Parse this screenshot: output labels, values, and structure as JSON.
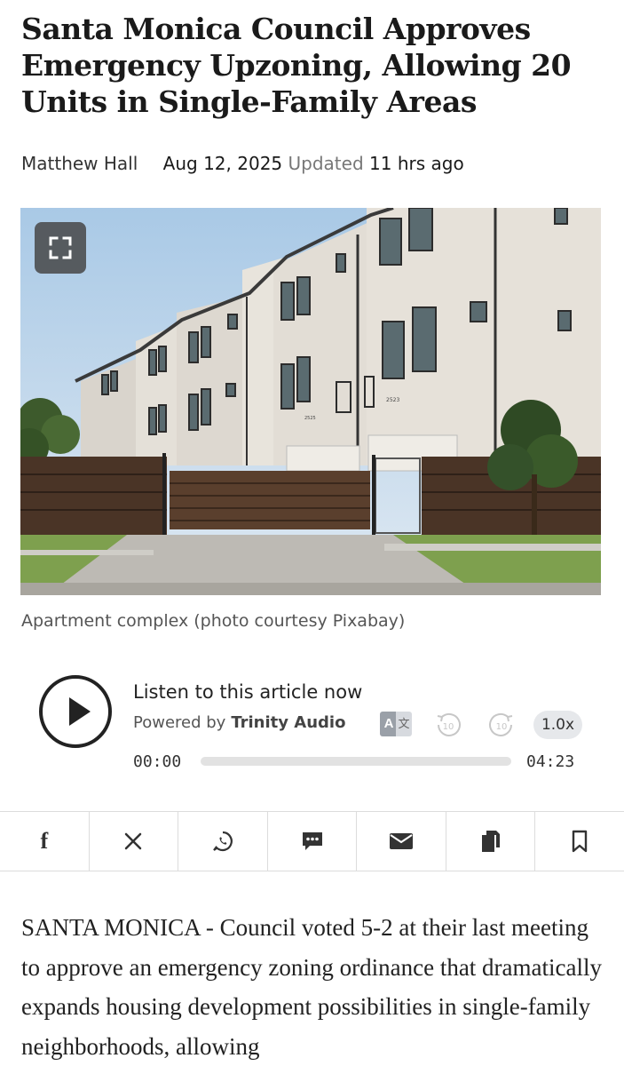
{
  "article": {
    "headline": "Santa Monica Council Approves Emergency Upzoning, Allowing 20 Units in Single-Family Areas",
    "author": "Matthew Hall",
    "date": "Aug 12, 2025",
    "updated_label": "Updated",
    "updated_ago": "11 hrs ago",
    "caption": "Apartment complex (photo courtesy Pixabay)",
    "body": "SANTA MONICA - Council voted 5-2 at their last meeting to approve an emergency zoning ordinance that dramatically expands housing development possibilities in single-family neighborhoods, allowing"
  },
  "hero": {
    "image_subject": "apartment-complex-photo",
    "unit_numbers": [
      "2523",
      "2525"
    ]
  },
  "player": {
    "title": "Listen to this article now",
    "powered_by": "Powered by",
    "brand": "Trinity Audio",
    "translate_a": "A",
    "translate_b": "文",
    "skip_back": "10",
    "skip_forward": "10",
    "speed": "1.0x",
    "current_time": "00:00",
    "total_time": "04:23",
    "progress": 0
  },
  "share": {
    "icons": [
      "facebook-icon",
      "x-icon",
      "whatsapp-icon",
      "comment-icon",
      "email-icon",
      "copy-icon",
      "bookmark-icon"
    ],
    "facebook_glyph": "f"
  },
  "colors": {
    "text": "#1a1a1a",
    "muted": "#777777",
    "divider": "#dcdcdc",
    "player_track": "#e2e2e2"
  }
}
